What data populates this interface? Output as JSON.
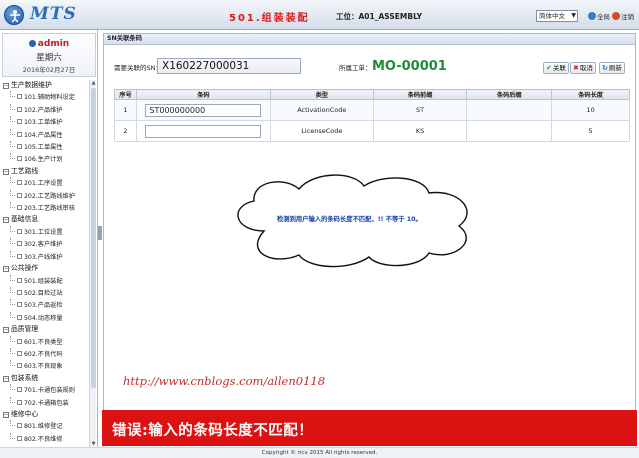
{
  "header": {
    "app_name": "MTS",
    "station_title": "501.组装装配",
    "station_label": "工位：A01_ASSEMBLY",
    "language": "简体中文",
    "link_all": "全局",
    "link_logout": "注销"
  },
  "sidebar": {
    "user": "admin",
    "weekday": "星期六",
    "date": "2016年02月27日",
    "groups": [
      {
        "title": "生产数据维护",
        "items": [
          "101.辅助物料设定",
          "102.产品维护",
          "103.工单维护",
          "104.产品属性",
          "105.工单属性",
          "106.生产计划"
        ]
      },
      {
        "title": "工艺路线",
        "items": [
          "201.工序设置",
          "202.工艺路线维护",
          "203.工艺路线审核"
        ]
      },
      {
        "title": "基础信息",
        "items": [
          "301.工位设置",
          "302.客户维护",
          "303.产线维护"
        ]
      },
      {
        "title": "公共操作",
        "items": [
          "501.组装装配",
          "502.目检过站",
          "503.产品返检",
          "504.动态称量"
        ]
      },
      {
        "title": "品质管理",
        "items": [
          "601.不良类型",
          "602.不良代码",
          "603.不良现象"
        ]
      },
      {
        "title": "包装系统",
        "items": [
          "701.卡通包装规则",
          "702.卡通箱包装"
        ]
      },
      {
        "title": "维修中心",
        "items": [
          "801.维修登记",
          "802.不良维修"
        ]
      }
    ]
  },
  "panel": {
    "title": "SN关联条码",
    "sn_label": "需要关联的SN：",
    "sn_value": "X160227000031",
    "wo_label": "所属工单：",
    "wo_value": "MO-00001",
    "buttons": {
      "link": "关联",
      "cancel": "取消",
      "refresh": "刷新"
    },
    "table": {
      "headers": [
        "序号",
        "条码",
        "类型",
        "条码前缀",
        "条码后缀",
        "条码长度"
      ],
      "rows": [
        {
          "index": "1",
          "barcode": "ST000000000",
          "type": "ActivationCode",
          "prefix": "ST",
          "suffix": "",
          "length": "10"
        },
        {
          "index": "2",
          "barcode": "",
          "type": "LicenseCode",
          "prefix": "KS",
          "suffix": "",
          "length": "5"
        }
      ]
    }
  },
  "cloud_message": "检测到用户输入的条码长度不匹配，!! 不等于 10。",
  "watermark": "http://www.cnblogs.com/allen0118",
  "error_message": "错误:输入的条码长度不匹配！",
  "footer": "Copyright © ricx 2015 All rights reserved.",
  "colors": {
    "accent": "#2c6fb8",
    "error_bar": "#dc1212",
    "work_order": "#1d8d36",
    "station_title": "#d81e1e"
  }
}
